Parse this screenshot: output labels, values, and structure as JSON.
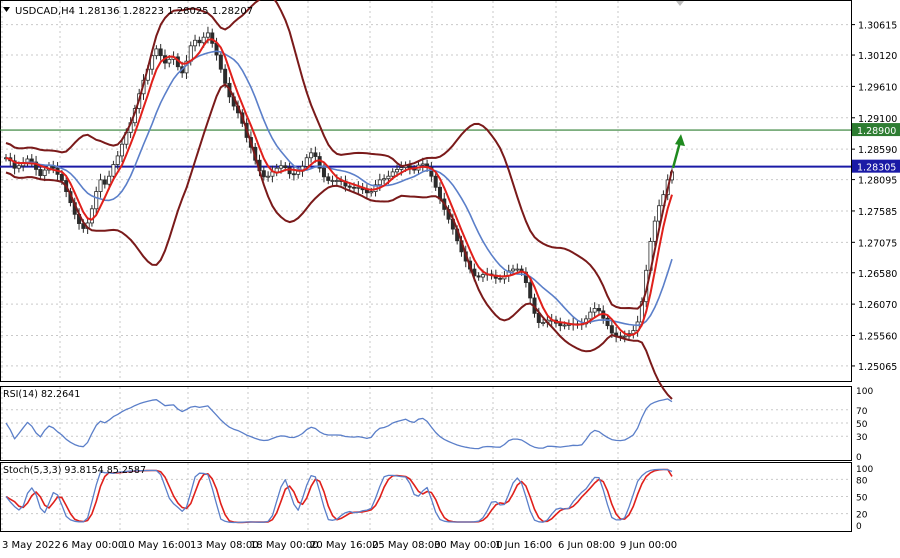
{
  "chart_data": [
    {
      "type": "candlestick",
      "symbol": "USDCAD",
      "timeframe": "H4",
      "header_text": "USDCAD,H4  1.28136 1.28223 1.28025 1.28207",
      "ohlc_last": {
        "open": 1.28136,
        "high": 1.28223,
        "low": 1.28025,
        "close": 1.28207
      },
      "ylim": [
        1.2482,
        1.3095
      ],
      "y_ticks": [
        "1.30615",
        "1.30120",
        "1.29610",
        "1.29100",
        "1.28590",
        "1.28095",
        "1.27585",
        "1.27075",
        "1.26580",
        "1.26070",
        "1.25560",
        "1.25065"
      ],
      "x_ticks": [
        "3 May 2022",
        "6 May 00:00",
        "10 May 16:00",
        "13 May 08:00",
        "18 May 00:00",
        "20 May 16:00",
        "25 May 08:00",
        "30 May 00:00",
        "1 Jun 16:00",
        "6 Jun 08:00",
        "9 Jun 00:00"
      ],
      "horizontal_levels": [
        {
          "value": 1.289,
          "label": "1.28900",
          "color": "#2e7d32"
        },
        {
          "value": 1.28305,
          "label": "1.28305",
          "color": "#1a1aa6"
        }
      ],
      "signal_arrow": {
        "direction": "up",
        "color": "#1f8a1f"
      },
      "colors": {
        "candles": "#2b2b2b",
        "ma_fast": "#e0201b",
        "ma_slow": "#5b7fc9",
        "bollinger": "#7a1a1a",
        "grid": "#c9c9c9"
      },
      "closes": [
        1.2845,
        1.284,
        1.2828,
        1.2832,
        1.2837,
        1.2843,
        1.2838,
        1.2826,
        1.2816,
        1.2825,
        1.2832,
        1.2828,
        1.2818,
        1.2808,
        1.279,
        1.2772,
        1.2753,
        1.2738,
        1.273,
        1.2739,
        1.2762,
        1.279,
        1.2809,
        1.2802,
        1.2815,
        1.2834,
        1.2848,
        1.2867,
        1.2886,
        1.2902,
        1.2925,
        1.2949,
        1.2971,
        1.2989,
        1.3011,
        1.3022,
        1.3011,
        1.2999,
        1.3005,
        1.3009,
        1.2993,
        1.2983,
        1.3002,
        1.3027,
        1.3036,
        1.3032,
        1.3041,
        1.3048,
        1.3031,
        1.3012,
        1.2989,
        1.2966,
        1.2944,
        1.2929,
        1.2918,
        1.2901,
        1.2878,
        1.2862,
        1.2841,
        1.2824,
        1.2814,
        1.2815,
        1.2822,
        1.2828,
        1.2832,
        1.2829,
        1.2819,
        1.2818,
        1.2823,
        1.2831,
        1.2845,
        1.2853,
        1.2847,
        1.2828,
        1.2814,
        1.2808,
        1.2808,
        1.2808,
        1.2807,
        1.2799,
        1.2797,
        1.2796,
        1.2797,
        1.2793,
        1.2788,
        1.279,
        1.2801,
        1.2809,
        1.2811,
        1.2815,
        1.2822,
        1.2826,
        1.2829,
        1.2832,
        1.2827,
        1.2825,
        1.2833,
        1.2835,
        1.2829,
        1.2815,
        1.2797,
        1.2778,
        1.2761,
        1.2745,
        1.2729,
        1.271,
        1.2692,
        1.2677,
        1.2664,
        1.2653,
        1.2651,
        1.2655,
        1.2656,
        1.2654,
        1.2649,
        1.2648,
        1.2653,
        1.2661,
        1.2664,
        1.2664,
        1.2659,
        1.2642,
        1.2617,
        1.2592,
        1.2577,
        1.2577,
        1.2581,
        1.2581,
        1.2576,
        1.2572,
        1.2573,
        1.2574,
        1.2575,
        1.2574,
        1.2575,
        1.2583,
        1.2594,
        1.26,
        1.2596,
        1.2584,
        1.2572,
        1.256,
        1.2555,
        1.2554,
        1.2555,
        1.2559,
        1.2564,
        1.2578,
        1.2611,
        1.2662,
        1.2709,
        1.2742,
        1.2767,
        1.2785,
        1.2809,
        1.2822
      ],
      "rsi": {
        "label": "RSI(14) 82.2641",
        "period": 14,
        "value": 82.2641,
        "ylim": [
          0,
          100
        ],
        "y_ticks": [
          "100",
          "70",
          "50",
          "30",
          "0"
        ],
        "color": "#5b7fc9"
      },
      "stochastic": {
        "label": "Stoch(5,3,3) 93.8154 85.2587",
        "params": [
          5,
          3,
          3
        ],
        "main": 93.8154,
        "signal": 85.2587,
        "ylim": [
          0,
          100
        ],
        "y_ticks": [
          "100",
          "80",
          "50",
          "20",
          "0"
        ],
        "colors": {
          "main": "#5b7fc9",
          "signal": "#e0201b"
        }
      }
    }
  ]
}
